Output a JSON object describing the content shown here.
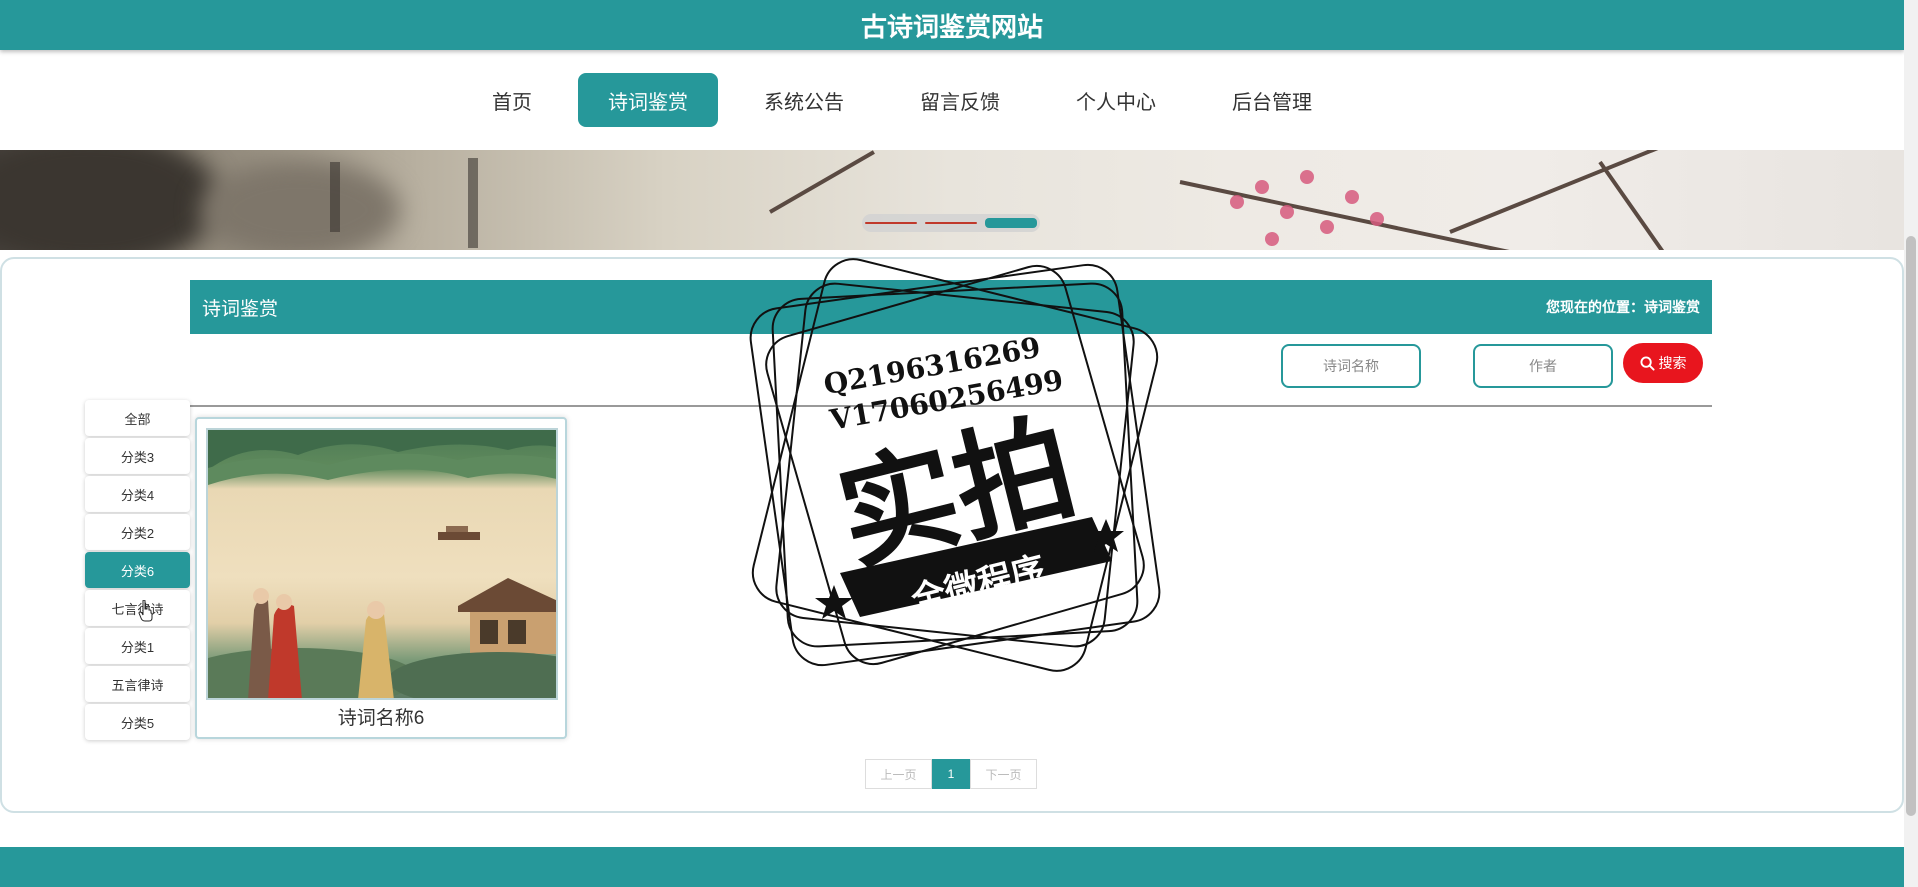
{
  "site": {
    "title": "古诗词鉴赏网站"
  },
  "nav": {
    "items": [
      {
        "label": "首页"
      },
      {
        "label": "诗词鉴赏"
      },
      {
        "label": "系统公告"
      },
      {
        "label": "留言反馈"
      },
      {
        "label": "个人中心"
      },
      {
        "label": "后台管理"
      }
    ],
    "active_index": 1
  },
  "banner": {
    "slide_count": 3,
    "active_slide": 3
  },
  "section": {
    "title": "诗词鉴赏",
    "breadcrumb": "您现在的位置：诗词鉴赏"
  },
  "search": {
    "name_placeholder": "诗词名称",
    "author_placeholder": "作者",
    "button_label": "搜索"
  },
  "categories": [
    {
      "label": "全部"
    },
    {
      "label": "分类3"
    },
    {
      "label": "分类4"
    },
    {
      "label": "分类2"
    },
    {
      "label": "分类6"
    },
    {
      "label": "七言律诗"
    },
    {
      "label": "分类1"
    },
    {
      "label": "五言律诗"
    },
    {
      "label": "分类5"
    }
  ],
  "active_category": "分类6",
  "poems": [
    {
      "title": "诗词名称6"
    }
  ],
  "pagination": {
    "prev": "上一页",
    "current": "1",
    "next": "下一页"
  },
  "watermark": {
    "line1": "Q2196316269",
    "line2": "V17060256499",
    "main": "实拍",
    "ribbon": "全微程序"
  },
  "colors": {
    "primary": "#26989a",
    "search_button": "#e8151e"
  }
}
